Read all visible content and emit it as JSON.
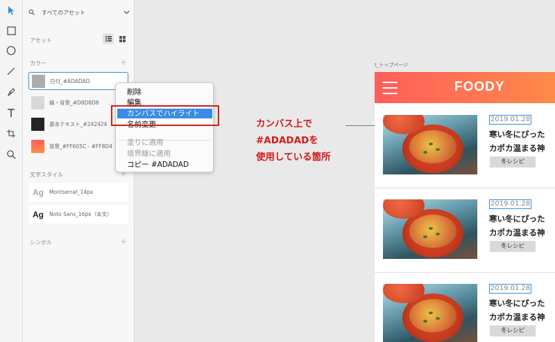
{
  "assets_panel": {
    "search_label": "すべてのアセット",
    "assets_section": "アセット",
    "colors_section": "カラー",
    "colors": [
      {
        "label": "日付_#ADADAD",
        "color": "#adadad"
      },
      {
        "label": "線・背景_#D8D8D8",
        "color": "#d8d8d8"
      },
      {
        "label": "基本テキスト_#242424",
        "color": "#242424"
      },
      {
        "label": "背景_#FF605C - #FF8D4",
        "color_start": "#ff605c",
        "color_end": "#ff8d4a"
      }
    ],
    "text_styles_section": "文字スタイル",
    "text_styles": [
      {
        "preview": "Ag",
        "label": "Montserrat_14px"
      },
      {
        "preview": "Ag",
        "label": "Noto Sans_16px（本文）"
      }
    ],
    "symbols_section": "シンボル"
  },
  "context_menu": {
    "items": [
      {
        "label": "削除"
      },
      {
        "label": "編集"
      },
      {
        "label": "カンバスでハイライト"
      },
      {
        "label": "名前変更"
      },
      {
        "label": "塗りに適用"
      },
      {
        "label": "境界線に適用"
      },
      {
        "label": "コピー #ADADAD"
      }
    ]
  },
  "annotation": {
    "line1": "カンバス上で",
    "line2": "#ADADADを",
    "line3": "使用している箇所",
    "color": "#d21a1a"
  },
  "artboard": {
    "name": "t_トップページ",
    "logo": "FOODY",
    "header_gradient": [
      "#ff5e5b",
      "#ff8a4a"
    ],
    "cards": [
      {
        "date": "2019.01.28",
        "title_line1": "寒い冬にぴった",
        "title_line2": "カポカ温まる神",
        "tag": "冬レシピ"
      },
      {
        "date": "2019.01.28",
        "title_line1": "寒い冬にぴった",
        "title_line2": "カポカ温まる神",
        "tag": "冬レシピ"
      },
      {
        "date": "2019.01.28",
        "title_line1": "寒い冬にぴった",
        "title_line2": "カポカ温まる神",
        "tag": "冬レシピ"
      }
    ]
  },
  "accent_color": "#3a8ce8"
}
